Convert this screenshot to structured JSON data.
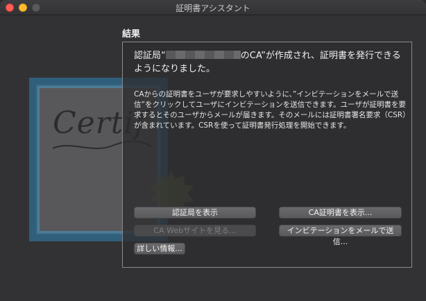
{
  "window": {
    "title": "証明書アシスタント"
  },
  "illustration": {
    "certificate_text": "Certif"
  },
  "section": {
    "title": "結果"
  },
  "message": {
    "prefix": "認証局“",
    "suffix": "のCA”が作成され、証明書を発行できるようになりました。",
    "body": "CAからの証明書をユーザが要求しやすいように、”インビテーションをメールで送信”をクリックしてユーザにインビテーションを送信できます。ユーザが証明書を要求するとそのユーザからメールが届きます。そのメールには証明書署名要求（CSR）が含まれています。CSRを使って証明書発行処理を開始できます。"
  },
  "buttons": {
    "show_ca": "認証局を表示",
    "show_ca_cert": "CA証明書を表示...",
    "ca_website": "CA Webサイトを見る...",
    "send_invitation": "インビテーションをメールで送信...",
    "details": "詳しい情報..."
  }
}
